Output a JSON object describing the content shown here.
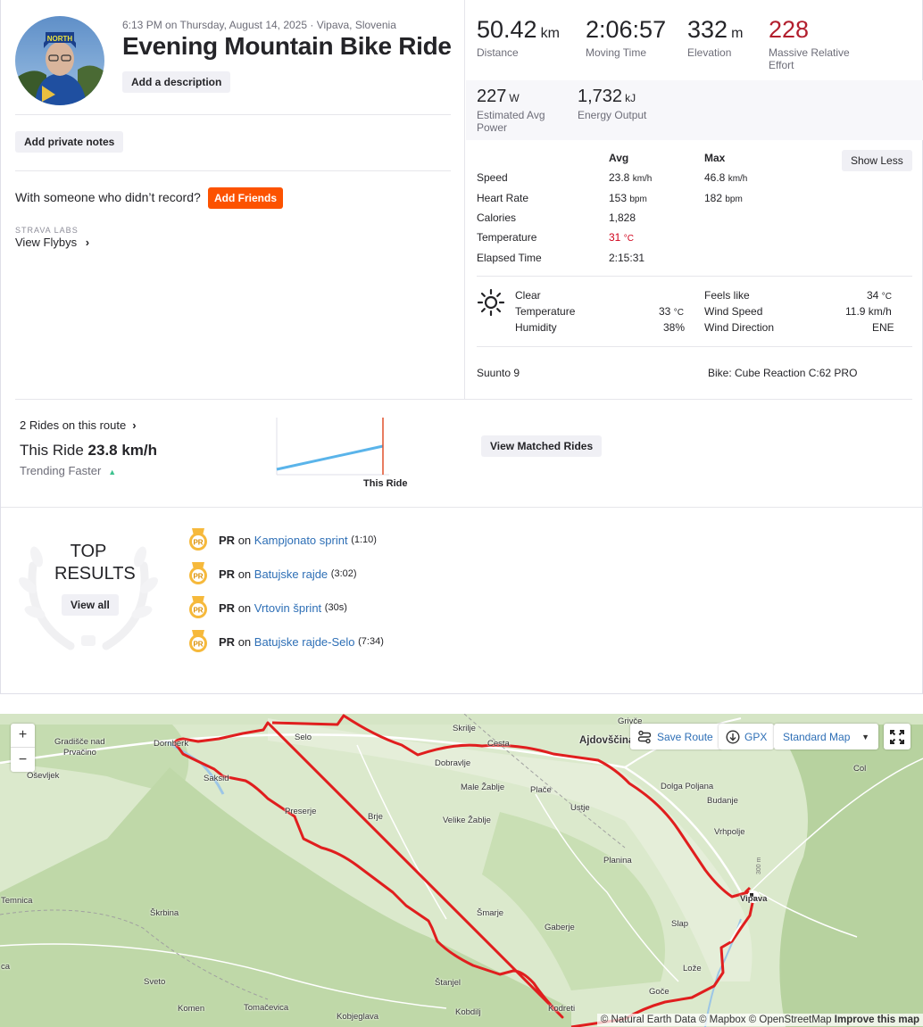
{
  "header": {
    "meta": "6:13 PM on Thursday, August 14, 2025 · Vipava, Slovenia",
    "title": "Evening Mountain Bike Ride",
    "add_description": "Add a description",
    "add_private_notes": "Add private notes",
    "with_someone": "With someone who didn’t record?",
    "add_friends": "Add Friends",
    "strava_labs": "STRAVA LABS",
    "view_flybys": "View Flybys"
  },
  "stats": {
    "distance": {
      "value": "50.42",
      "unit": "km",
      "label": "Distance"
    },
    "moving_time": {
      "value": "2:06:57",
      "label": "Moving Time"
    },
    "elevation": {
      "value": "332",
      "unit": "m",
      "label": "Elevation"
    },
    "effort": {
      "value": "228",
      "label_line1": "Massive Relative",
      "label_line2": "Effort"
    },
    "power": {
      "value": "227",
      "unit": "W",
      "label_line1": "Estimated Avg",
      "label_line2": "Power"
    },
    "energy": {
      "value": "1,732",
      "unit": "kJ",
      "label": "Energy Output"
    }
  },
  "details": {
    "col_avg": "Avg",
    "col_max": "Max",
    "show_less": "Show Less",
    "rows": [
      {
        "label": "Speed",
        "avg": "23.8",
        "avg_unit": "km/h",
        "max": "46.8",
        "max_unit": "km/h"
      },
      {
        "label": "Heart Rate",
        "avg": "153",
        "avg_unit": "bpm",
        "max": "182",
        "max_unit": "bpm"
      },
      {
        "label": "Calories",
        "avg": "1,828",
        "avg_unit": "",
        "max": "",
        "max_unit": ""
      },
      {
        "label": "Temperature",
        "avg": "31",
        "avg_unit": "°C",
        "max": "",
        "max_unit": ""
      },
      {
        "label": "Elapsed Time",
        "avg": "2:15:31",
        "avg_unit": "",
        "max": "",
        "max_unit": ""
      }
    ]
  },
  "weather": {
    "condition": "Clear",
    "temperature_label": "Temperature",
    "temperature": "33",
    "temperature_unit": "°C",
    "humidity_label": "Humidity",
    "humidity": "38%",
    "feels_like_label": "Feels like",
    "feels_like": "34",
    "feels_like_unit": "°C",
    "wind_speed_label": "Wind Speed",
    "wind_speed": "11.9 km/h",
    "wind_direction_label": "Wind Direction",
    "wind_direction": "ENE"
  },
  "device": "Suunto 9",
  "bike": "Bike: Cube Reaction C:62 PRO",
  "rides": {
    "count_link": "2 Rides on this route",
    "this_ride_label": "This Ride",
    "this_ride_value": "23.8 km/h",
    "trending": "Trending Faster",
    "chart_label": "This Ride",
    "view_matched": "View Matched Rides"
  },
  "top_results": {
    "title_line1": "TOP",
    "title_line2": "RESULTS",
    "view_all": "View all",
    "items": [
      {
        "badge": "PR",
        "on": "on",
        "segment": "Kampjonato sprint",
        "time": "(1:10)"
      },
      {
        "badge": "PR",
        "on": "on",
        "segment": "Batujske rajde",
        "time": "(3:02)"
      },
      {
        "badge": "PR",
        "on": "on",
        "segment": "Vrtovin šprint",
        "time": "(30s)"
      },
      {
        "badge": "PR",
        "on": "on",
        "segment": "Batujske rajde-Selo",
        "time": "(7:34)"
      }
    ]
  },
  "map": {
    "zoom_in": "+",
    "zoom_out": "−",
    "save_route": "Save Route",
    "gpx": "GPX",
    "map_type": "Standard Map",
    "attribution": "© Natural Earth Data © Mapbox © OpenStreetMap",
    "improve": "Improve this map",
    "elevation_marker": "300 m",
    "towns": {
      "gradisce": "Gradišče nad",
      "prvacino": "Prvačino",
      "dornberk": "Dornberk",
      "osevljek": "Oševljek",
      "saksid": "Saksid",
      "selo": "Selo",
      "skrilje": "Skrilje",
      "cesta": "Cesta",
      "grivce": "Grivče",
      "ajdovscina": "Ajdovščina",
      "col": "Col",
      "dobravlje": "Dobravlje",
      "male_zablje": "Male Žablje",
      "place": "Plače",
      "dolga_poljana": "Dolga Poljana",
      "budanje": "Budanje",
      "preserje": "Preserje",
      "brje": "Brje",
      "velike_zablje": "Velike Žablje",
      "ustje": "Ustje",
      "vrhpolje": "Vrhpolje",
      "planina": "Planina",
      "temnica": "Temnica",
      "skrbina": "Škrbina",
      "smarje": "Šmarje",
      "vipava": "Vipava",
      "slap": "Slap",
      "gaberje": "Gaberje",
      "ca": "ca",
      "loze": "Lože",
      "sveto": "Sveto",
      "stanjel": "Štanjel",
      "goce": "Goče",
      "komen": "Komen",
      "tomacevica": "Tomačevica",
      "kobjeglava": "Kobjeglava",
      "kobdilj": "Kobdilj",
      "kodreti": "Kodreti"
    }
  },
  "colors": {
    "accent": "#fc5200",
    "effort": "#b21e2d",
    "link": "#2e6fb6",
    "route": "#e01e1e",
    "temp_red": "#d0021b"
  }
}
